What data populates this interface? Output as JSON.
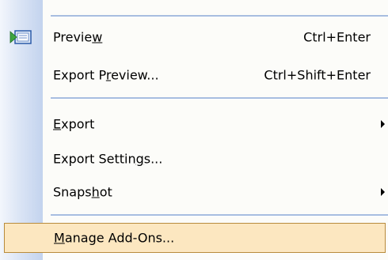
{
  "menu": {
    "items": [
      {
        "label_pre": "Previe",
        "label_u": "w",
        "label_post": "",
        "shortcut": "Ctrl+Enter"
      },
      {
        "label_pre": "Export P",
        "label_u": "r",
        "label_post": "eview...",
        "shortcut": "Ctrl+Shift+Enter"
      },
      {
        "label_pre": "",
        "label_u": "E",
        "label_post": "xport"
      },
      {
        "label_pre": "Export Settin",
        "label_u": "g",
        "label_post": "s..."
      },
      {
        "label_pre": "Snaps",
        "label_u": "h",
        "label_post": "ot"
      },
      {
        "label_pre": "",
        "label_u": "M",
        "label_post": "anage Add-Ons..."
      }
    ]
  },
  "icons": {
    "preview": "preview-icon",
    "submenu": "submenu-arrow-icon"
  },
  "colors": {
    "highlight_bg": "#fce7c0",
    "highlight_border": "#b88b3c",
    "separator": "#a7bde0",
    "gutter": "#c3d3ee"
  }
}
